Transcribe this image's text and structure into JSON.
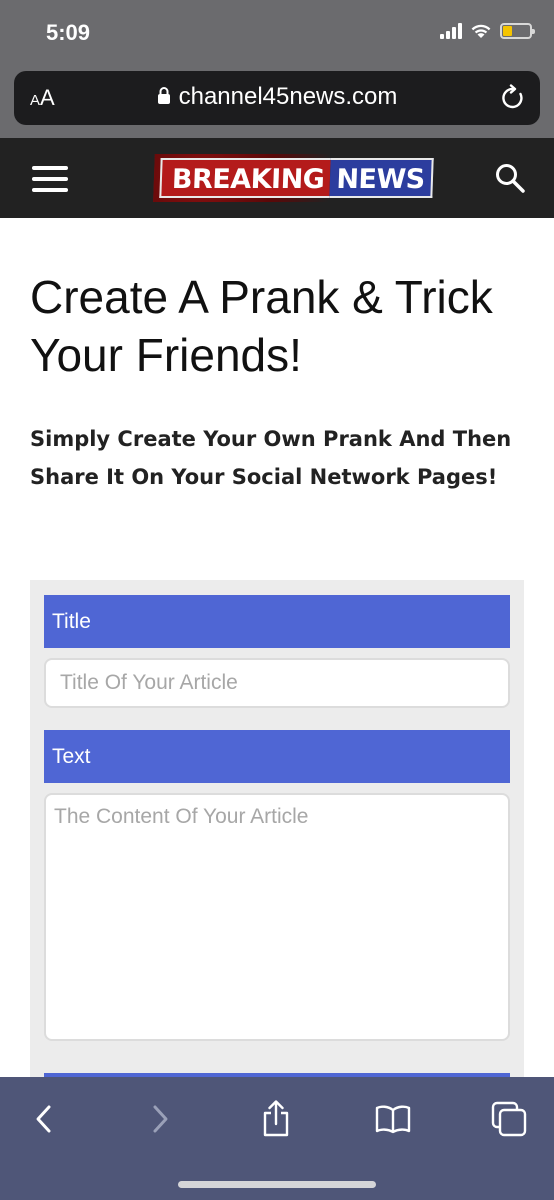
{
  "status_bar": {
    "time": "5:09"
  },
  "browser": {
    "aa_label_small": "A",
    "aa_label_large": "A",
    "url": "channel45news.com"
  },
  "site": {
    "logo_part1": "BREAKING",
    "logo_part2": "NEWS"
  },
  "main": {
    "title": "Create A Prank & Trick Your Friends!",
    "subtitle": "Simply Create Your Own Prank And Then Share It On Your Social Network Pages!"
  },
  "form": {
    "title_label": "Title",
    "title_placeholder": "Title Of Your Article",
    "text_label": "Text",
    "text_placeholder": "The Content Of Your Article"
  },
  "colors": {
    "label_bg": "#4f66d4",
    "header_bg": "#222222",
    "logo_red": "#b41b1b",
    "logo_blue": "#2c3d9e",
    "toolbar_bg": "#4f5678"
  },
  "icons": [
    "lock-icon",
    "reload-icon",
    "hamburger-menu-icon",
    "search-icon",
    "back-icon",
    "forward-icon",
    "share-icon",
    "bookmarks-icon",
    "tabs-icon",
    "signal-icon",
    "wifi-icon",
    "battery-icon"
  ]
}
